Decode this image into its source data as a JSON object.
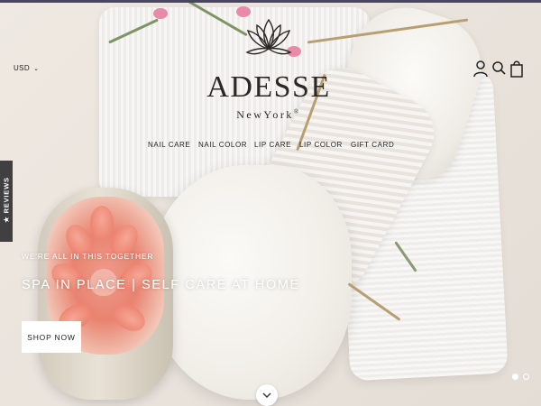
{
  "header": {
    "currency": "USD",
    "brand_name": "ADESSE",
    "brand_sub": "NewYork",
    "brand_mark": "®"
  },
  "icons": {
    "account": "account-icon",
    "search": "search-icon",
    "cart": "cart-icon",
    "lotus": "lotus-logo-icon",
    "chevron": "chevron-down-icon"
  },
  "nav": {
    "items": [
      {
        "label": "NAIL CARE"
      },
      {
        "label": "NAIL COLOR"
      },
      {
        "label": "LIP CARE"
      },
      {
        "label": "LIP COLOR"
      },
      {
        "label": "GIFT CARD"
      }
    ]
  },
  "reviews_tab": {
    "label": "★ REVIEWS"
  },
  "hero": {
    "eyebrow": "WE'RE ALL IN THIS TOGETHER",
    "headline": "SPA IN PLACE | SELF CARE AT HOME",
    "cta_label": "SHOP NOW"
  },
  "slider": {
    "total": 2,
    "active": 1
  },
  "colors": {
    "topbar": "#4a4660",
    "text_dark": "#222222",
    "reviews_bg": "#404040",
    "button_bg": "#ffffff"
  }
}
